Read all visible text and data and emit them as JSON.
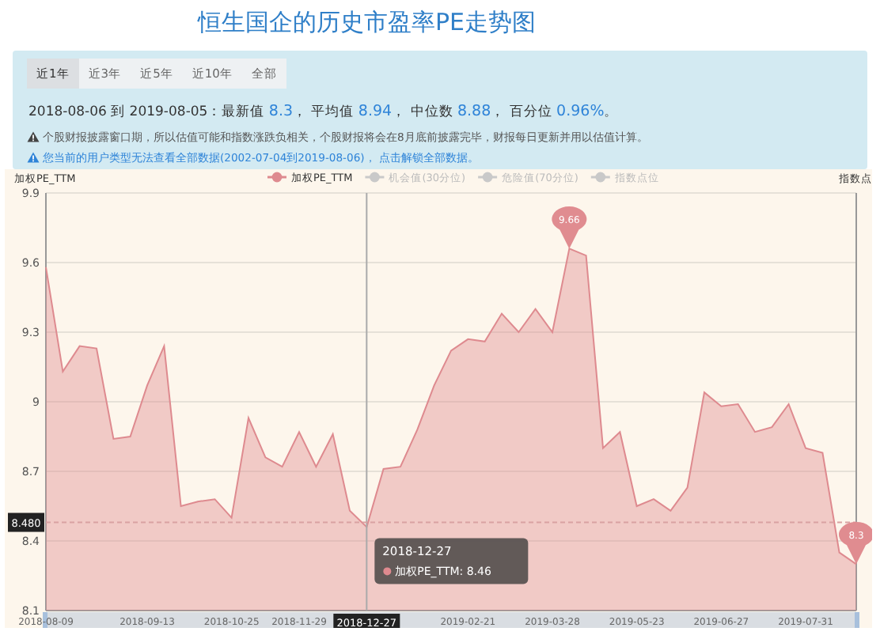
{
  "title": "恒生国企的历史市盈率PE走势图",
  "period_tabs": [
    {
      "label": "近1年",
      "selected": true
    },
    {
      "label": "近3年",
      "selected": false
    },
    {
      "label": "近5年",
      "selected": false
    },
    {
      "label": "近10年",
      "selected": false
    },
    {
      "label": "全部",
      "selected": false
    }
  ],
  "summary": {
    "range": "2018-08-06 到 2019-08-05：",
    "stats": [
      {
        "label": "最新值",
        "value": "8.3",
        "sep": "，"
      },
      {
        "label": "平均值",
        "value": "8.94",
        "sep": "，"
      },
      {
        "label": "中位数",
        "value": "8.88",
        "sep": "，"
      },
      {
        "label": "百分位",
        "value": "0.96%",
        "sep": "。"
      }
    ]
  },
  "notices": [
    {
      "kind": "warning",
      "text": "个股财报披露窗口期，所以估值可能和指数涨跌负相关，个股财报将会在8月底前披露完毕，财报每日更新并用以估值计算。"
    },
    {
      "kind": "info",
      "text": "您当前的用户类型无法查看全部数据(2002-07-04到2019-08-06)， 点击解锁全部数据。"
    }
  ],
  "chart": {
    "right_axis_name": "指数点",
    "legend": [
      {
        "kind": "series",
        "selected": true
      },
      {
        "kind": "reference",
        "label": "机会值(30分位)",
        "selected": false
      },
      {
        "kind": "reference",
        "label": "危险值(70分位)",
        "selected": false
      },
      {
        "kind": "reference",
        "label": "指数点位",
        "selected": false
      }
    ],
    "axis_pointer": {
      "x_label": "2018-12-27"
    },
    "tooltip": {
      "title": "2018-12-27",
      "sep": ": ",
      "value": "8.46"
    },
    "mark_points": [
      {
        "kind": "max",
        "label": "9.66"
      },
      {
        "kind": "last",
        "label": "8.3"
      }
    ],
    "chart_data": {
      "type": "area",
      "ylabel": "加权PE_TTM",
      "grid": true,
      "ref_lines": [
        {
          "axis": "y",
          "value": 8.48,
          "label": "8.480"
        }
      ],
      "ylim": [
        8.1,
        9.9
      ],
      "yticks": [
        8.1,
        8.4,
        8.7,
        9,
        9.3,
        9.6,
        9.9
      ],
      "categories": [
        "2018-08-09",
        null,
        null,
        null,
        null,
        null,
        "2018-09-13",
        null,
        null,
        null,
        null,
        "2018-10-25",
        null,
        null,
        null,
        "2018-11-29",
        null,
        null,
        null,
        null,
        null,
        null,
        null,
        null,
        null,
        "2019-02-21",
        null,
        null,
        null,
        null,
        "2019-03-28",
        null,
        null,
        null,
        null,
        "2019-05-23",
        null,
        null,
        null,
        null,
        "2019-06-27",
        null,
        null,
        null,
        null,
        "2019-07-31",
        null,
        null,
        null
      ],
      "series": [
        {
          "name": "加权PE_TTM",
          "color": "#de8a8f",
          "values": [
            9.58,
            9.13,
            9.24,
            9.23,
            8.84,
            8.85,
            9.07,
            9.24,
            8.55,
            8.57,
            8.58,
            8.5,
            8.93,
            8.76,
            8.72,
            8.87,
            8.72,
            8.86,
            8.53,
            8.46,
            8.71,
            8.72,
            8.88,
            9.07,
            9.22,
            9.27,
            9.26,
            9.38,
            9.3,
            9.4,
            9.3,
            9.66,
            9.63,
            8.8,
            8.87,
            8.55,
            8.58,
            8.53,
            8.63,
            9.04,
            8.98,
            8.99,
            8.87,
            8.89,
            8.99,
            8.8,
            8.78,
            8.35,
            8.3
          ]
        }
      ]
    }
  }
}
